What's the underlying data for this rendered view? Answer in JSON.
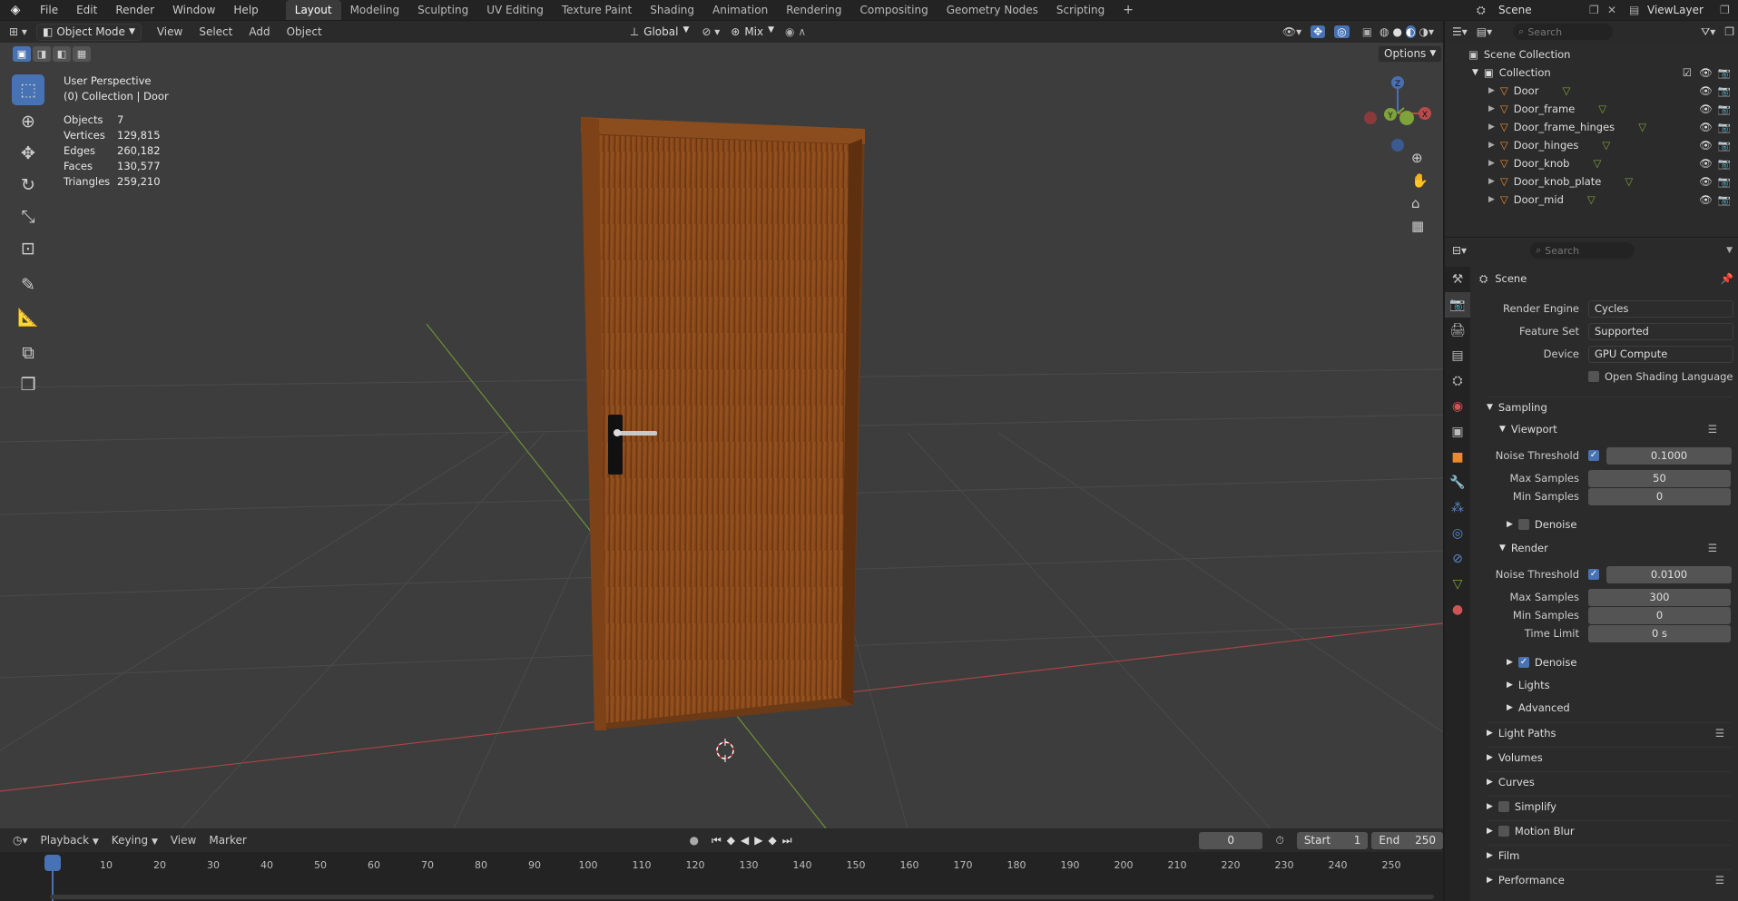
{
  "menu": {
    "items": [
      "File",
      "Edit",
      "Render",
      "Window",
      "Help"
    ]
  },
  "workspaces": {
    "tabs": [
      "Layout",
      "Modeling",
      "Sculpting",
      "UV Editing",
      "Texture Paint",
      "Shading",
      "Animation",
      "Rendering",
      "Compositing",
      "Geometry Nodes",
      "Scripting"
    ],
    "active": "Layout",
    "add": "+"
  },
  "scene": {
    "name": "Scene",
    "view_layer": "ViewLayer"
  },
  "viewport_header": {
    "mode": "Object Mode",
    "menus": [
      "View",
      "Select",
      "Add",
      "Object"
    ],
    "orientation": "Global",
    "snap": "Mix",
    "options": "Options"
  },
  "viewport": {
    "perspective": "User Perspective",
    "context": "(0) Collection | Door",
    "stats": [
      {
        "label": "Objects",
        "value": "7"
      },
      {
        "label": "Vertices",
        "value": "129,815"
      },
      {
        "label": "Edges",
        "value": "260,182"
      },
      {
        "label": "Faces",
        "value": "130,577"
      },
      {
        "label": "Triangles",
        "value": "259,210"
      }
    ],
    "gizmo": {
      "x": "X",
      "y": "Y",
      "z": "Z"
    }
  },
  "outliner": {
    "search_placeholder": "Search",
    "scene_collection": "Scene Collection",
    "collection": "Collection",
    "objects": [
      "Door",
      "Door_frame",
      "Door_frame_hinges",
      "Door_hinges",
      "Door_knob",
      "Door_knob_plate",
      "Door_mid"
    ]
  },
  "properties": {
    "search_placeholder": "Search",
    "context": "Scene",
    "render_engine": {
      "label": "Render Engine",
      "value": "Cycles"
    },
    "feature_set": {
      "label": "Feature Set",
      "value": "Supported"
    },
    "device": {
      "label": "Device",
      "value": "GPU Compute"
    },
    "osl": "Open Shading Language",
    "sampling": "Sampling",
    "viewport_sec": "Viewport",
    "vp_noise": {
      "label": "Noise Threshold",
      "value": "0.1000"
    },
    "vp_max": {
      "label": "Max Samples",
      "value": "50"
    },
    "vp_min": {
      "label": "Min Samples",
      "value": "0"
    },
    "vp_denoise": "Denoise",
    "render_sec": "Render",
    "r_noise": {
      "label": "Noise Threshold",
      "value": "0.0100"
    },
    "r_max": {
      "label": "Max Samples",
      "value": "300"
    },
    "r_min": {
      "label": "Min Samples",
      "value": "0"
    },
    "r_time": {
      "label": "Time Limit",
      "value": "0 s"
    },
    "r_denoise": "Denoise",
    "lights": "Lights",
    "advanced": "Advanced",
    "sections": [
      "Light Paths",
      "Volumes",
      "Curves",
      "Simplify",
      "Motion Blur",
      "Film",
      "Performance"
    ]
  },
  "timeline": {
    "menus": [
      "Playback",
      "Keying",
      "View",
      "Marker"
    ],
    "current_frame": "0",
    "start_label": "Start",
    "start": "1",
    "end_label": "End",
    "end": "250",
    "ticks": [
      "0",
      "10",
      "20",
      "30",
      "40",
      "50",
      "60",
      "70",
      "80",
      "90",
      "100",
      "110",
      "120",
      "130",
      "140",
      "150",
      "160",
      "170",
      "180",
      "190",
      "200",
      "210",
      "220",
      "230",
      "240",
      "250"
    ]
  },
  "colors": {
    "accent": "#4772b3",
    "door_wood": "#8a4a1c",
    "x_axis": "#b84a4a",
    "y_axis": "#7ea33a"
  }
}
